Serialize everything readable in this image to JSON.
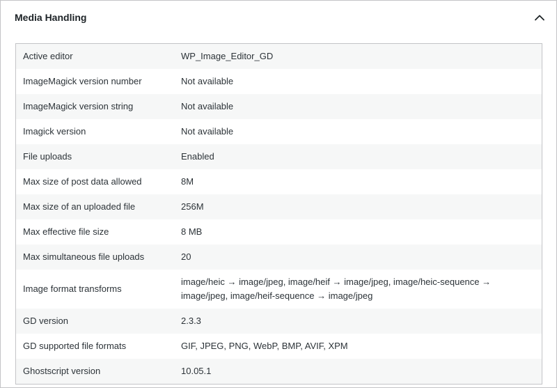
{
  "section": {
    "title": "Media Handling",
    "toggle_icon": "chevron-up-icon"
  },
  "rows": [
    {
      "label": "Active editor",
      "value": "WP_Image_Editor_GD"
    },
    {
      "label": "ImageMagick version number",
      "value": "Not available"
    },
    {
      "label": "ImageMagick version string",
      "value": "Not available"
    },
    {
      "label": "Imagick version",
      "value": "Not available"
    },
    {
      "label": "File uploads",
      "value": "Enabled"
    },
    {
      "label": "Max size of post data allowed",
      "value": "8M"
    },
    {
      "label": "Max size of an uploaded file",
      "value": "256M"
    },
    {
      "label": "Max effective file size",
      "value": "8 MB"
    },
    {
      "label": "Max simultaneous file uploads",
      "value": "20"
    },
    {
      "label": "Image format transforms",
      "value": "image/heic → image/jpeg, image/heif → image/jpeg, image/heic-sequence → image/jpeg, image/heif-sequence → image/jpeg"
    },
    {
      "label": "GD version",
      "value": "2.3.3"
    },
    {
      "label": "GD supported file formats",
      "value": "GIF, JPEG, PNG, WebP, BMP, AVIF, XPM"
    },
    {
      "label": "Ghostscript version",
      "value": "10.05.1"
    }
  ]
}
